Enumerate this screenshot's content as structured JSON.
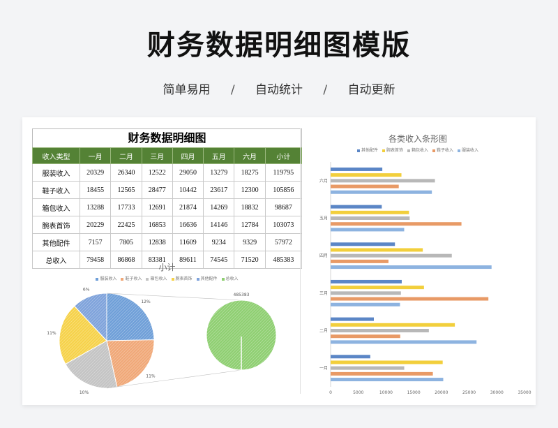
{
  "header": {
    "title": "财务数据明细图模版"
  },
  "subtitle": {
    "items": [
      "简单易用",
      "自动统计",
      "自动更新"
    ],
    "separator": "/"
  },
  "table": {
    "title": "财务数据明细图",
    "columns": [
      "收入类型",
      "一月",
      "二月",
      "三月",
      "四月",
      "五月",
      "六月",
      "小计"
    ],
    "rows": [
      [
        "服装收入",
        "20329",
        "26340",
        "12522",
        "29050",
        "13279",
        "18275",
        "119795"
      ],
      [
        "鞋子收入",
        "18455",
        "12565",
        "28477",
        "10442",
        "23617",
        "12300",
        "105856"
      ],
      [
        "箱包收入",
        "13288",
        "17733",
        "12691",
        "21874",
        "14269",
        "18832",
        "98687"
      ],
      [
        "腕表首饰",
        "20229",
        "22425",
        "16853",
        "16636",
        "14146",
        "12784",
        "103073"
      ],
      [
        "其他配件",
        "7157",
        "7805",
        "12838",
        "11609",
        "9234",
        "9329",
        "57972"
      ],
      [
        "总收入",
        "79458",
        "86868",
        "83381",
        "89611",
        "74545",
        "71520",
        "485383"
      ]
    ],
    "colors": {
      "header_bg": "#548235",
      "header_text": "#ffffff"
    }
  },
  "chart_data": [
    {
      "type": "pie",
      "title": "小计",
      "legend": [
        "服装收入",
        "鞋子收入",
        "箱包收入",
        "腕表首饰",
        "其他配件",
        "总收入"
      ],
      "slice_labels": [
        "12%",
        "11%",
        "10%",
        "11%",
        "6%"
      ],
      "total_label": "485383",
      "values": [
        119795,
        105856,
        98687,
        103073,
        57972,
        485383
      ],
      "colors": [
        "#6f9fd8",
        "#f0a878",
        "#c4c4c4",
        "#f6d24a",
        "#7fa3db",
        "#8fcf72"
      ],
      "legend_placement": "top"
    },
    {
      "type": "bar",
      "orientation": "horizontal",
      "title": "各类收入条形图",
      "categories": [
        "一月",
        "二月",
        "三月",
        "四月",
        "五月",
        "六月"
      ],
      "series": [
        {
          "name": "其他配件",
          "values": [
            7157,
            7805,
            12838,
            11609,
            9234,
            9329
          ],
          "color": "#5b86c6"
        },
        {
          "name": "腕表首饰",
          "values": [
            20229,
            22425,
            16853,
            16636,
            14146,
            12784
          ],
          "color": "#f2cf3c"
        },
        {
          "name": "箱包收入",
          "values": [
            13288,
            17733,
            12691,
            21874,
            14269,
            18832
          ],
          "color": "#b8b8b8"
        },
        {
          "name": "鞋子收入",
          "values": [
            18455,
            12565,
            28477,
            10442,
            23617,
            12300
          ],
          "color": "#e89a66"
        },
        {
          "name": "服装收入",
          "values": [
            20329,
            26340,
            12522,
            29050,
            13279,
            18275
          ],
          "color": "#8db3e0"
        }
      ],
      "xticks": [
        "0",
        "5000",
        "10000",
        "15000",
        "20000",
        "25000",
        "30000",
        "35000"
      ],
      "xlim": [
        0,
        35000
      ],
      "legend_placement": "top"
    }
  ]
}
